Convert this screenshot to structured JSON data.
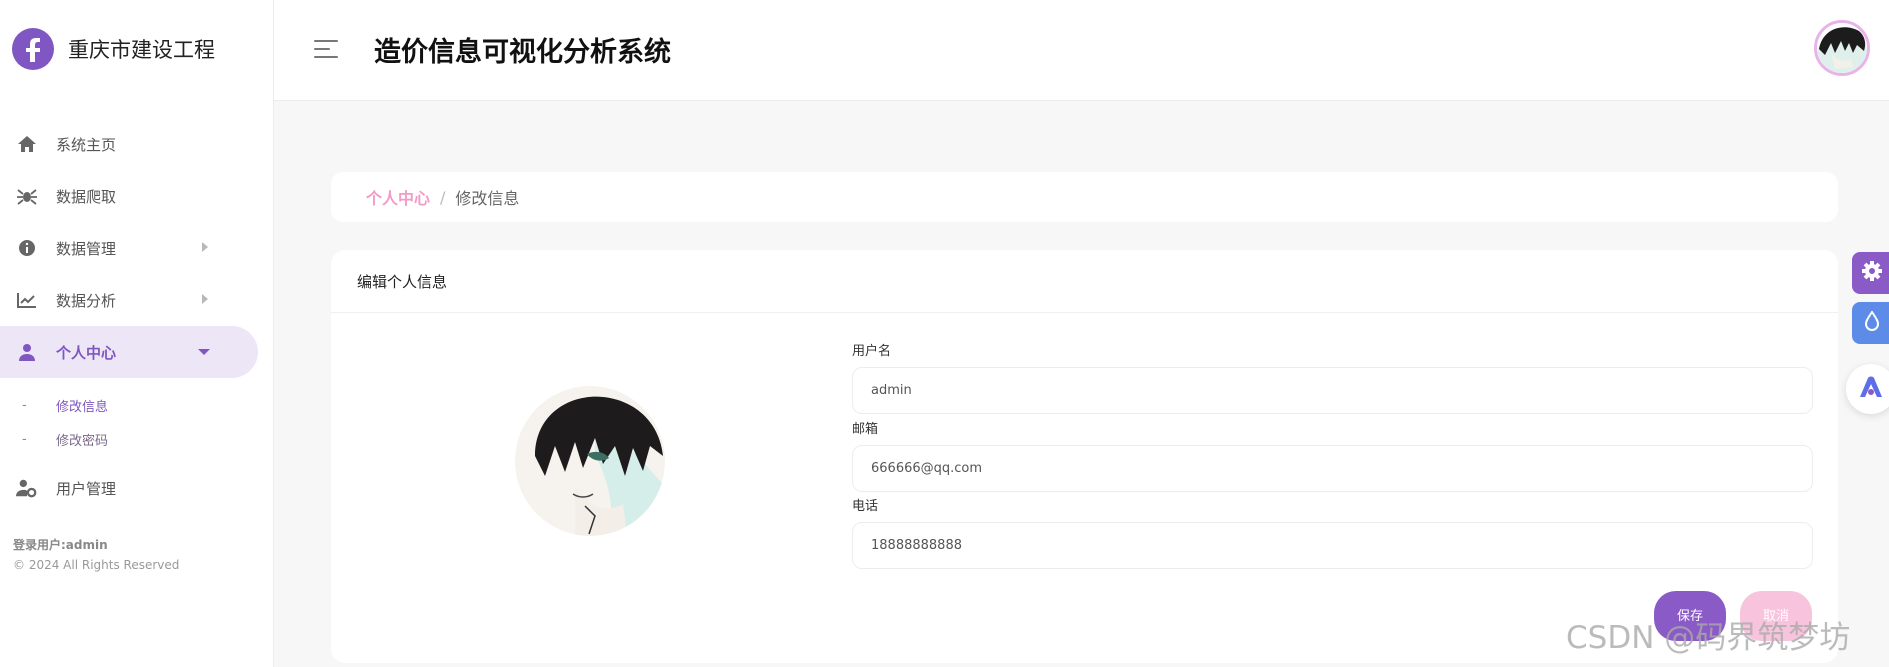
{
  "sidebar": {
    "brand_name": "重庆市建设工程",
    "items": [
      {
        "label": "系统主页",
        "icon": "home-icon"
      },
      {
        "label": "数据爬取",
        "icon": "spider-icon"
      },
      {
        "label": "数据管理",
        "icon": "info-icon"
      },
      {
        "label": "数据分析",
        "icon": "chart-line-icon"
      },
      {
        "label": "个人中心",
        "icon": "user-icon"
      },
      {
        "label": "用户管理",
        "icon": "user-gear-icon"
      }
    ],
    "sub_items": [
      {
        "dash": "-",
        "label": "修改信息"
      },
      {
        "dash": "-",
        "label": "修改密码"
      }
    ],
    "login_user": "登录用户:admin",
    "copyright": "© 2024 All Rights Reserved"
  },
  "header": {
    "title": "造价信息可视化分析系统"
  },
  "breadcrumb": {
    "parent": "个人中心",
    "separator": "/",
    "current": "修改信息"
  },
  "form": {
    "title": "编辑个人信息",
    "username_label": "用户名",
    "username_value": "admin",
    "email_label": "邮箱",
    "email_value": "666666@qq.com",
    "phone_label": "电话",
    "phone_value": "18888888888",
    "save_label": "保存",
    "cancel_label": "取消"
  },
  "watermark": "CSDN @码界筑梦坊",
  "colors": {
    "accent": "#7f56c2",
    "accent_light": "#ede6f7",
    "pink": "#f29bc8",
    "blue": "#5d8ce8"
  }
}
